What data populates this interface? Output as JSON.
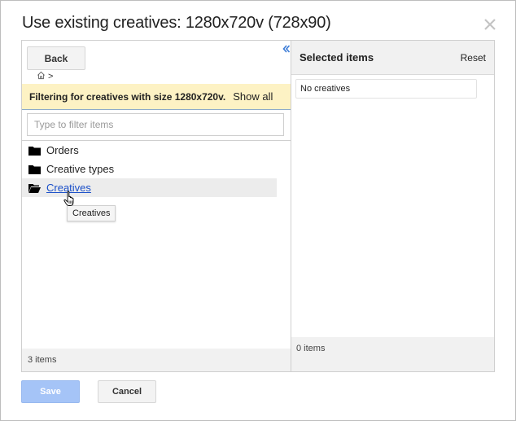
{
  "dialog": {
    "title": "Use existing creatives: 1280x720v (728x90)",
    "close_icon": "close-icon"
  },
  "left_pane": {
    "back_label": "Back",
    "breadcrumb": {
      "home_icon": "home-icon",
      "separator": ">"
    },
    "filter_message": "Filtering for creatives with size 1280x720v.",
    "show_all_label": "Show all",
    "filter_input": {
      "placeholder": "Type to filter items",
      "value": ""
    },
    "tree_items": [
      {
        "label": "Orders",
        "icon": "folder-icon",
        "state": "normal"
      },
      {
        "label": "Creative types",
        "icon": "folder-icon",
        "state": "normal"
      },
      {
        "label": "Creatives",
        "icon": "folder-open-icon",
        "state": "hover"
      }
    ],
    "tooltip": "Creatives",
    "footer": "3 items",
    "collapse_icon": "collapse-left-icon"
  },
  "right_pane": {
    "header": "Selected items",
    "reset_label": "Reset",
    "empty_message": "No creatives",
    "footer": "0 items"
  },
  "actions": {
    "save_label": "Save",
    "cancel_label": "Cancel"
  },
  "colors": {
    "filter_bar_bg": "#fdf2c4",
    "link": "#1a4fc9",
    "save_disabled": "#a5c4f7",
    "pane_gray": "#f1f1f1"
  }
}
